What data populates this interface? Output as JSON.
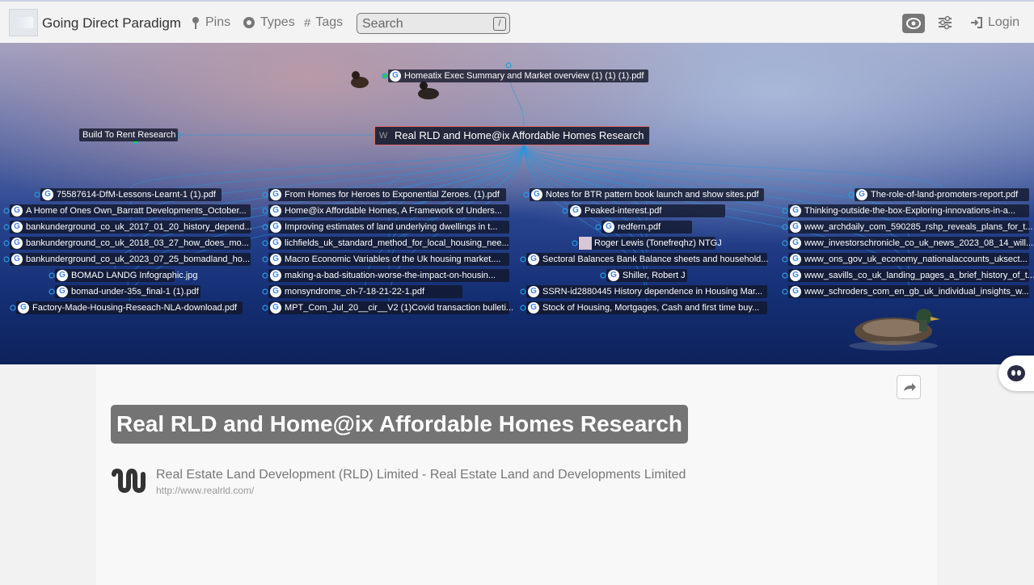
{
  "header": {
    "site_title": "Going Direct Paradigm",
    "nav": [
      {
        "label": "Pins",
        "icon": "pin-icon"
      },
      {
        "label": "Types",
        "icon": "circle-icon"
      },
      {
        "label": "Tags",
        "icon": "hash-icon"
      }
    ],
    "search_placeholder": "Search",
    "search_shortcut": "/",
    "login_label": "Login"
  },
  "graph": {
    "hub": "Real RLD and Home@ix Affordable Homes Research",
    "top_node": "Homeatix Exec Summary and Market overview (1) (1) (1).pdf",
    "left_node": "Build To Rent Research",
    "col1": [
      "75587614-DfM-Lessons-Learnt-1 (1).pdf",
      "A Home of Ones Own_Barratt Developments_October...",
      "bankunderground_co_uk_2017_01_20_history_depend...",
      "bankunderground_co_uk_2018_03_27_how_does_mo...",
      "bankunderground_co_uk_2023_07_25_bomadland_ho...",
      "BOMAD LANDG Infographic.jpg",
      "bomad-under-35s_final-1 (1).pdf",
      "Factory-Made-Housing-Reseach-NLA-download.pdf"
    ],
    "col2": [
      "From Homes for Heroes to Exponential Zeroes. (1).pdf",
      "Home@ix Affordable Homes, A Framework of Unders...",
      "Improving estimates of land underlying dwellings in t...",
      "lichfields_uk_standard_method_for_local_housing_nee...",
      "Macro Economic Variables of the Uk housing market....",
      "making-a-bad-situation-worse-the-impact-on-housin...",
      "monsyndrome_ch-7-18-21-22-1.pdf",
      "MPT_Com_Jul_20__cir__V2 (1)Covid transaction bulleti..."
    ],
    "col3": [
      "Notes for BTR pattern book launch and show sites.pdf",
      "Peaked-interest.pdf",
      "redfern.pdf",
      "Roger Lewis (Tonefreqhz) NTGJ",
      "Sectoral Balances Bank Balance sheets and household...",
      "Shiller, Robert J",
      "SSRN-id2880445 History dependence in Housing Mar...",
      "Stock of Housing, Mortgages, Cash and first time buy..."
    ],
    "col4": [
      "The-role-of-land-promoters-report.pdf",
      "Thinking-outside-the-box-Exploring-innovations-in-a...",
      "www_archdaily_com_590285_rshp_reveals_plans_for_t...",
      "www_investorschronicle_co_uk_news_2023_08_14_will...",
      "www_ons_gov_uk_economy_nationalaccounts_uksect...",
      "www_savills_co_uk_landing_pages_a_brief_history_of_t...",
      "www_schroders_com_en_gb_uk_individual_insights_w..."
    ]
  },
  "content": {
    "title": "Real RLD and Home@ix Affordable Homes Research",
    "link_title": "Real Estate Land Development (RLD) Limited - Real Estate Land and Developments Limited",
    "link_url": "http://www.realrld.com/"
  }
}
